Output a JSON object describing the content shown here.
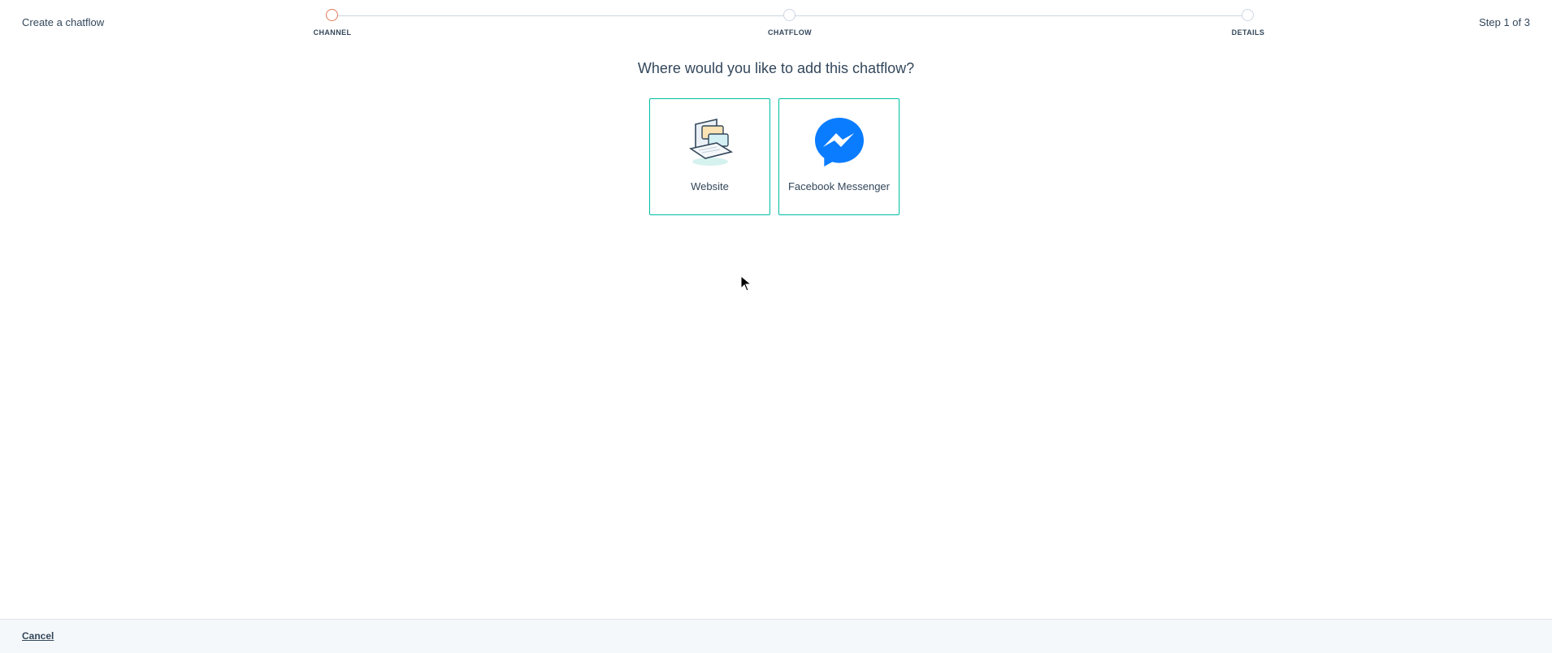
{
  "header": {
    "title": "Create a chatflow",
    "step_indicator": "Step 1 of 3"
  },
  "stepper": {
    "steps": [
      {
        "label": "CHANNEL",
        "active": true
      },
      {
        "label": "CHATFLOW",
        "active": false
      },
      {
        "label": "DETAILS",
        "active": false
      }
    ]
  },
  "main": {
    "question": "Where would you like to add this chatflow?",
    "options": [
      {
        "label": "Website",
        "icon": "laptop-chat-icon"
      },
      {
        "label": "Facebook Messenger",
        "icon": "messenger-icon"
      }
    ]
  },
  "footer": {
    "cancel_label": "Cancel"
  },
  "colors": {
    "accent_active_step": "#e07a5a",
    "card_border": "#00bda5",
    "text": "#33475b",
    "messenger_blue": "#0084ff"
  }
}
